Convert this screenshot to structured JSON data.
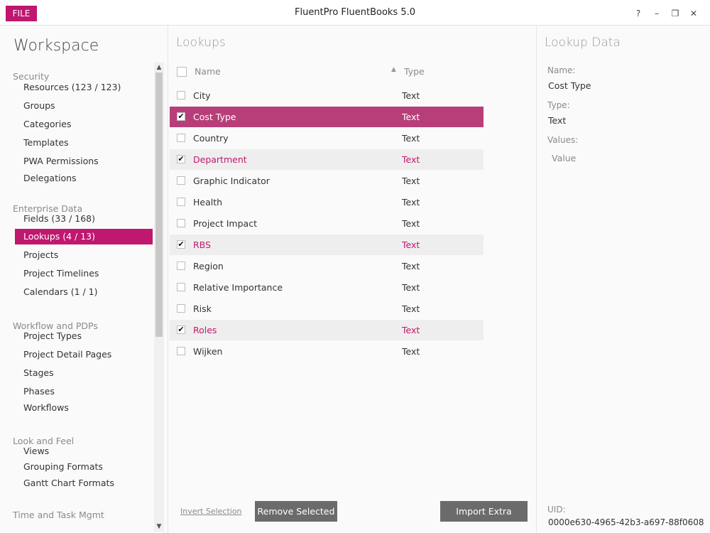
{
  "titlebar": {
    "file_label": "FILE",
    "app_title": "FluentPro FluentBooks 5.0",
    "help": "?",
    "minimize": "–",
    "restore": "❐",
    "close": "✕"
  },
  "workspace": {
    "title": "Workspace",
    "groups": [
      {
        "label": "Security",
        "items": [
          "Resources (123 / 123)",
          "Groups",
          "Categories",
          "Templates",
          "PWA Permissions",
          "Delegations"
        ]
      },
      {
        "label": "Enterprise Data",
        "items": [
          "Fields (33 / 168)",
          "Lookups (4 / 13)",
          "Projects",
          "Project Timelines",
          "Calendars (1 / 1)"
        ]
      },
      {
        "label": "Workflow and PDPs",
        "items": [
          "Project Types",
          "Project Detail Pages",
          "Stages",
          "Phases",
          "Workflows"
        ]
      },
      {
        "label": "Look and Feel",
        "items": [
          "Views",
          "Grouping Formats",
          "Gantt Chart Formats"
        ]
      },
      {
        "label": "Time and Task Mgmt",
        "items": []
      }
    ],
    "active_item": "Lookups (4 / 13)"
  },
  "lookups": {
    "title": "Lookups",
    "header_name": "Name",
    "header_type": "Type",
    "rows": [
      {
        "name": "City",
        "type": "Text",
        "checked": false
      },
      {
        "name": "Cost Type",
        "type": "Text",
        "checked": true
      },
      {
        "name": "Country",
        "type": "Text",
        "checked": false
      },
      {
        "name": "Department",
        "type": "Text",
        "checked": true
      },
      {
        "name": "Graphic Indicator",
        "type": "Text",
        "checked": false
      },
      {
        "name": "Health",
        "type": "Text",
        "checked": false
      },
      {
        "name": "Project Impact",
        "type": "Text",
        "checked": false
      },
      {
        "name": "RBS",
        "type": "Text",
        "checked": true
      },
      {
        "name": "Region",
        "type": "Text",
        "checked": false
      },
      {
        "name": "Relative Importance",
        "type": "Text",
        "checked": false
      },
      {
        "name": "Risk",
        "type": "Text",
        "checked": false
      },
      {
        "name": "Roles",
        "type": "Text",
        "checked": true
      },
      {
        "name": "Wijken",
        "type": "Text",
        "checked": false
      }
    ],
    "invert_label": "Invert Selection",
    "remove_label": "Remove Selected",
    "import_label": "Import Extra"
  },
  "lookup_data": {
    "title": "Lookup Data",
    "name_label": "Name:",
    "name_value": "Cost Type",
    "type_label": "Type:",
    "type_value": "Text",
    "values_label": "Values:",
    "values_column": "Value",
    "uid_label": "UID:",
    "uid_value": "0000e630-4965-42b3-a697-88f0608"
  },
  "colors": {
    "accent": "#c0176f",
    "selected_row": "#b73e78",
    "button": "#6b6b6b"
  }
}
